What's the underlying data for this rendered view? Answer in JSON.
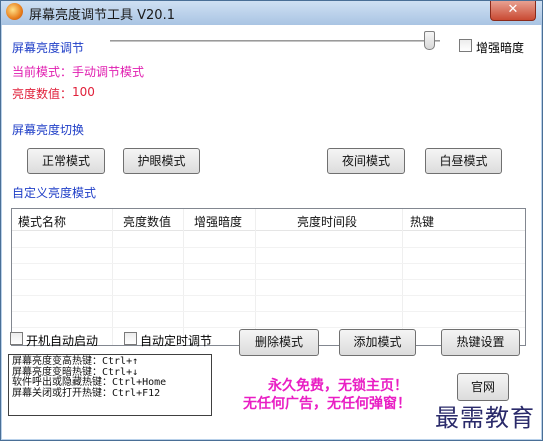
{
  "window": {
    "title": "屏幕亮度调节工具 V20.1",
    "close_label": "✕"
  },
  "brightness": {
    "label": "屏幕亮度调节",
    "slider_value_fraction": 0.97,
    "enhance_dark_label": "增强暗度",
    "current_mode_prefix": "当前模式：",
    "current_mode": "手动调节模式",
    "value_prefix": "亮度数值：",
    "value": "100"
  },
  "switch_section": {
    "label": "屏幕亮度切换",
    "buttons": [
      "正常模式",
      "护眼模式",
      "夜间模式",
      "白昼模式"
    ]
  },
  "custom_section": {
    "label": "自定义亮度模式",
    "columns": [
      "模式名称",
      "亮度数值",
      "增强暗度",
      "亮度时间段",
      "热键"
    ],
    "rows": []
  },
  "options": {
    "autostart_label": "开机自动启动",
    "auto_timer_label": "自动定时调节"
  },
  "actions": {
    "delete": "删除模式",
    "add": "添加模式",
    "hotkey": "热键设置"
  },
  "hotkeys": [
    "屏幕亮度变高热键：Ctrl+↑",
    "屏幕亮度变暗热键：Ctrl+↓",
    "软件呼出或隐藏热键：Ctrl+Home",
    "屏幕关闭或打开热键：Ctrl+F12"
  ],
  "promo": {
    "line1": "永久免费，无锁主页！",
    "line2": "无任何广告，无任何弹窗！"
  },
  "website_button": "官网",
  "watermark": "最需教育",
  "colors": {
    "section_blue": "#1f3ec7",
    "mode_magenta": "#e01eb0",
    "value_red": "#e0203a",
    "promo_magenta": "#e91ec4"
  }
}
